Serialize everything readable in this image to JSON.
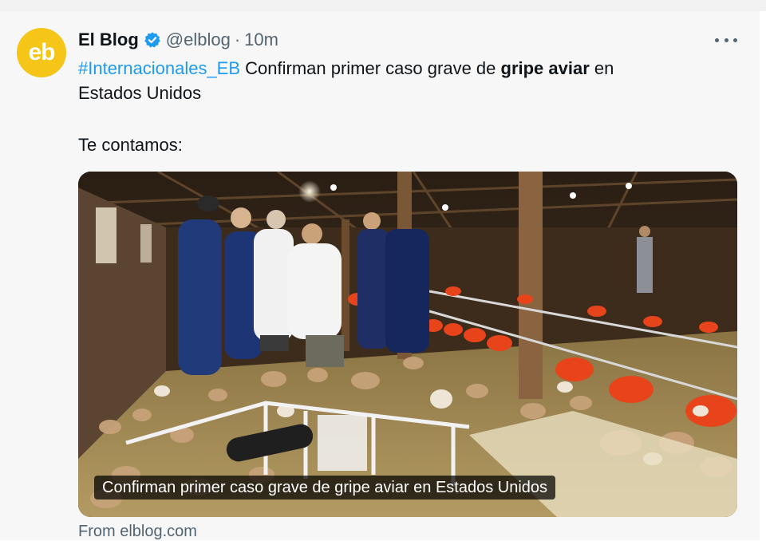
{
  "tweet": {
    "avatar_text": "eb",
    "author_name": "El Blog",
    "handle": "@elblog",
    "separator": "·",
    "time": "10m",
    "hashtag": "#Internacionales_EB",
    "text_part1": " Confirman primer caso grave de ",
    "text_bold": "gripe aviar",
    "text_part2": " en",
    "text_line2": "Estados Unidos",
    "text_line3": "Te contamos:",
    "media_caption": "Confirman primer caso grave de gripe aviar en Estados Unidos",
    "source": "From elblog.com"
  },
  "colors": {
    "avatar_bg": "#f5c518",
    "hashtag": "#1d9bf0",
    "verified": "#1d9bf0",
    "muted_text": "#536471"
  },
  "icons": {
    "verified": "verified-badge-icon",
    "more": "more-options-icon"
  }
}
